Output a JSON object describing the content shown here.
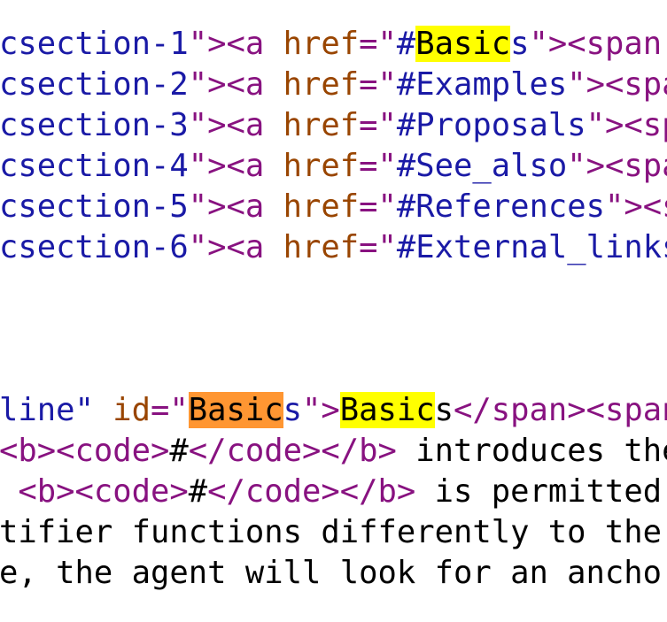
{
  "toc_lines": [
    {
      "pre": "csection-1",
      "q1": "\">",
      "tag": "<a",
      "sp": " ",
      "attr": "href",
      "eq": "=\"",
      "hash": "#",
      "match": "Basic",
      "rest": "s",
      "q2": "\">",
      "tail": "<span"
    },
    {
      "pre": "csection-2",
      "q1": "\">",
      "tag": "<a",
      "sp": " ",
      "attr": "href",
      "eq": "=\"",
      "hash": "#Examples",
      "q2": "\">",
      "tail": "<spa"
    },
    {
      "pre": "csection-3",
      "q1": "\">",
      "tag": "<a",
      "sp": " ",
      "attr": "href",
      "eq": "=\"",
      "hash": "#Proposals",
      "q2": "\">",
      "tail": "<sp"
    },
    {
      "pre": "csection-4",
      "q1": "\">",
      "tag": "<a",
      "sp": " ",
      "attr": "href",
      "eq": "=\"",
      "hash": "#See_also",
      "q2": "\">",
      "tail": "<spa"
    },
    {
      "pre": "csection-5",
      "q1": "\">",
      "tag": "<a",
      "sp": " ",
      "attr": "href",
      "eq": "=\"",
      "hash": "#References",
      "q2": "\">",
      "tail": "<s"
    },
    {
      "pre": "csection-6",
      "q1": "\">",
      "tag": "<a",
      "sp": " ",
      "attr": "href",
      "eq": "=\"",
      "hash": "#External_links",
      "q2": "",
      "tail": ""
    }
  ],
  "heading_line": {
    "pre": "line\"",
    "sp": " ",
    "attr": "id",
    "eq": "=\"",
    "match_current": "Basic",
    "rest1": "s",
    "q": "\">",
    "match2": "Basic",
    "rest2": "s",
    "close": "</span><span"
  },
  "body_lines": [
    {
      "open": "<b><code>",
      "hash": "#",
      "close": "</code></b>",
      "text": " introduces the"
    },
    {
      "lead": " ",
      "open": "<b><code>",
      "hash": "#",
      "close": "</code></b>",
      "text": " is permitted"
    },
    {
      "text": "tifier functions differently to the"
    },
    {
      "text": "e, the agent will look for an anchor"
    }
  ],
  "colors": {
    "attr_value": "#1a1aa6",
    "tag": "#881280",
    "attr_name": "#994500",
    "text": "#000000",
    "highlight_match": "#ffff00",
    "highlight_current": "#ff9632"
  }
}
